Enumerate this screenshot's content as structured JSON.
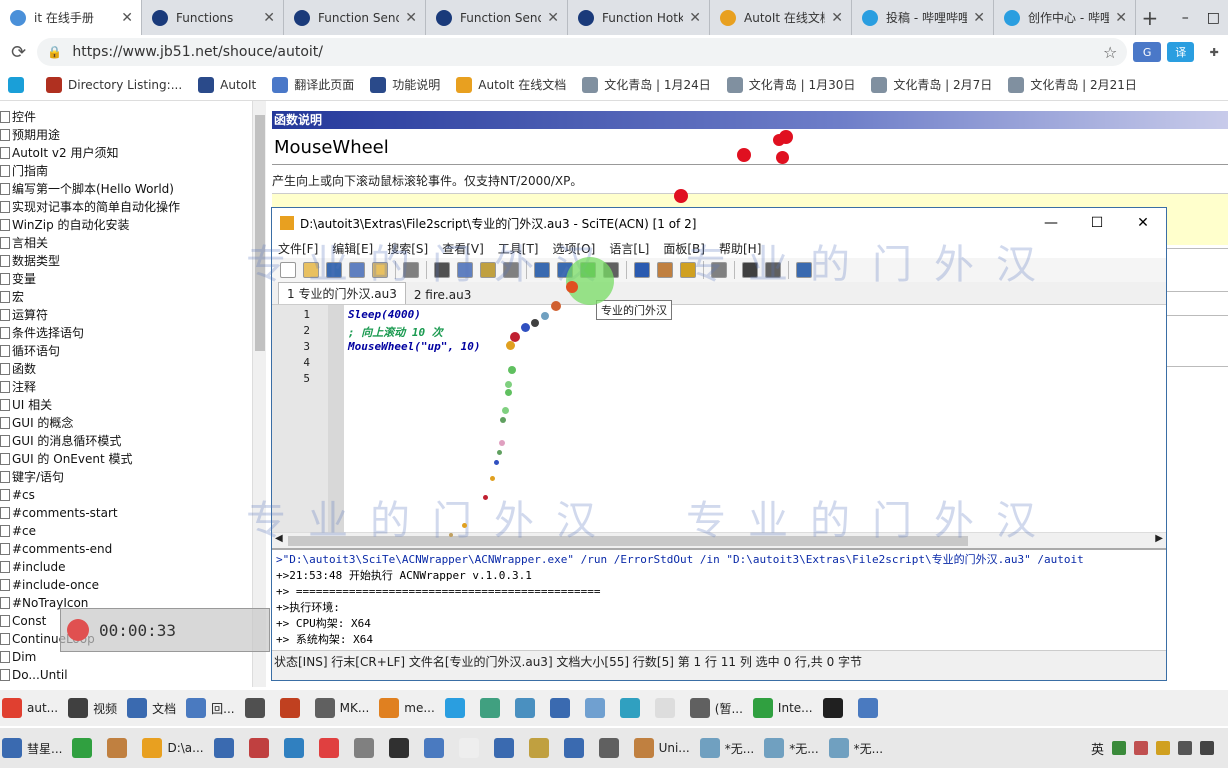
{
  "browser": {
    "tabs": [
      {
        "label": "it 在线手册",
        "color": "#4a90d9"
      },
      {
        "label": "Functions",
        "color": "#1a3a7a"
      },
      {
        "label": "Function Send",
        "color": "#1a3a7a"
      },
      {
        "label": "Function Send",
        "color": "#1a3a7a"
      },
      {
        "label": "Function Hotk",
        "color": "#1a3a7a"
      },
      {
        "label": "AutoIt 在线文档",
        "color": "#e8a020"
      },
      {
        "label": "投稿 - 哔哩哔哩",
        "color": "#2a9ee0"
      },
      {
        "label": "创作中心 - 哔哩",
        "color": "#2a9ee0"
      }
    ],
    "new_tab": "+",
    "url": "https://www.jb51.net/shouce/autoit/",
    "bookmarks": [
      {
        "label": "",
        "color": "#1a9fd8"
      },
      {
        "label": "Directory Listing:...",
        "color": "#b03020"
      },
      {
        "label": "AutoIt",
        "color": "#2a4a8a"
      },
      {
        "label": "翻译此页面",
        "color": "#4a78c8"
      },
      {
        "label": "功能说明",
        "color": "#2a4a8a"
      },
      {
        "label": "AutoIt 在线文档",
        "color": "#e8a020"
      },
      {
        "label": "文化青岛 | 1月24日",
        "color": "#8090a0"
      },
      {
        "label": "文化青岛 | 1月30日",
        "color": "#8090a0"
      },
      {
        "label": "文化青岛 | 2月7日",
        "color": "#8090a0"
      },
      {
        "label": "文化青岛 | 2月21日",
        "color": "#8090a0"
      }
    ]
  },
  "nav": {
    "items": [
      "控件",
      "预期用途",
      "AutoIt v2 用户须知",
      "门指南",
      "编写第一个脚本(Hello World)",
      "实现对记事本的简单自动化操作",
      "WinZip 的自动化安装",
      "言相关",
      "数据类型",
      "变量",
      "宏",
      "运算符",
      "条件选择语句",
      "循环语句",
      "函数",
      "注释",
      "UI 相关",
      "GUI 的概念",
      "GUI 的消息循环模式",
      "GUI 的 OnEvent 模式",
      "键字/语句",
      "#cs",
      "#comments-start",
      "#ce",
      "#comments-end",
      "#include",
      "#include-once",
      "#NoTrayIcon",
      "Const",
      "ContinueLoop",
      "Dim",
      "Do...Until"
    ]
  },
  "doc": {
    "header": "函数说明",
    "function_name": "MouseWheel",
    "description": "产生向上或向下滚动鼠标滚轮事件。仅支持NT/2000/XP。"
  },
  "scite": {
    "title": "D:\\autoit3\\Extras\\File2script\\专业的门外汉.au3 - SciTE(ACN) [1 of 2]",
    "menu": [
      "文件[F]",
      "编辑[E]",
      "搜索[S]",
      "查看[V]",
      "工具[T]",
      "选项[O]",
      "语言[L]",
      "面板[B]",
      "帮助[H]"
    ],
    "tabs": [
      "1 专业的门外汉.au3",
      "2 fire.au3"
    ],
    "tooltip": "专业的门外汉",
    "code": [
      {
        "num": "1",
        "text": "Sleep(4000)",
        "color": "#0000a0"
      },
      {
        "num": "2",
        "text": "; 向上滚动 10 次",
        "color": "#1a9a50"
      },
      {
        "num": "3",
        "text": "MouseWheel(\"up\", 10)",
        "color": "#0000a0"
      },
      {
        "num": "4",
        "text": "",
        "color": "#000"
      },
      {
        "num": "5",
        "text": "",
        "color": "#000"
      }
    ],
    "output": [
      ">\"D:\\autoit3\\SciTe\\ACNWrapper\\ACNWrapper.exe\" /run /ErrorStdOut /in \"D:\\autoit3\\Extras\\File2script\\专业的门外汉.au3\" /autoit",
      "+>21:53:48 开始执行 ACNWrapper v.1.0.3.1",
      "+> ==============================================",
      "+>执行环境:",
      "+>      CPU构架:        X64",
      "+>      系统构架:       X64"
    ],
    "status": "状态[INS] 行末[CR+LF] 文件名[专业的门外汉.au3] 文档大小[55] 行数[5] 第 1 行 11 列 选中 0 行,共 0 字节"
  },
  "watermark": "专业的门外汉",
  "recorder": {
    "time": "00:00:33"
  },
  "taskbar1": [
    {
      "label": "aut...",
      "color": "#e04030"
    },
    {
      "label": "视频",
      "color": "#404040"
    },
    {
      "label": "文档",
      "color": "#3a6ab0"
    },
    {
      "label": "回...",
      "color": "#4a7ac0"
    },
    {
      "label": "",
      "color": "#505050"
    },
    {
      "label": "",
      "color": "#c04020"
    },
    {
      "label": "MK...",
      "color": "#606060"
    },
    {
      "label": "me...",
      "color": "#e08020"
    },
    {
      "label": "",
      "color": "#2a9ee0"
    },
    {
      "label": "",
      "color": "#40a080"
    },
    {
      "label": "",
      "color": "#4a90c0"
    },
    {
      "label": "",
      "color": "#3a6ab0"
    },
    {
      "label": "",
      "color": "#70a0d0"
    },
    {
      "label": "",
      "color": "#30a0c0"
    },
    {
      "label": "",
      "color": "#dddddd"
    },
    {
      "label": "(暂...",
      "color": "#606060"
    },
    {
      "label": "Inte...",
      "color": "#30a040"
    },
    {
      "label": "",
      "color": "#202020"
    },
    {
      "label": "",
      "color": "#4a7ac0"
    }
  ],
  "taskbar2": [
    {
      "label": "彗星...",
      "color": "#3a6ab0"
    },
    {
      "label": "",
      "color": "#30a040"
    },
    {
      "label": "",
      "color": "#c08040"
    },
    {
      "label": "D:\\a...",
      "color": "#e8a020"
    },
    {
      "label": "",
      "color": "#3a6ab0"
    },
    {
      "label": "",
      "color": "#c04040"
    },
    {
      "label": "",
      "color": "#3080c0"
    },
    {
      "label": "",
      "color": "#e04040"
    },
    {
      "label": "",
      "color": "#808080"
    },
    {
      "label": "",
      "color": "#303030"
    },
    {
      "label": "",
      "color": "#4a7ac0"
    },
    {
      "label": "",
      "color": "#eeeeee"
    },
    {
      "label": "",
      "color": "#3a6ab0"
    },
    {
      "label": "",
      "color": "#c0a040"
    },
    {
      "label": "",
      "color": "#3a6ab0"
    },
    {
      "label": "",
      "color": "#606060"
    },
    {
      "label": "Uni...",
      "color": "#c08040"
    },
    {
      "label": "*无...",
      "color": "#70a0c0"
    },
    {
      "label": "*无...",
      "color": "#70a0c0"
    },
    {
      "label": "*无...",
      "color": "#70a0c0"
    }
  ],
  "tray": {
    "ime": "英"
  }
}
